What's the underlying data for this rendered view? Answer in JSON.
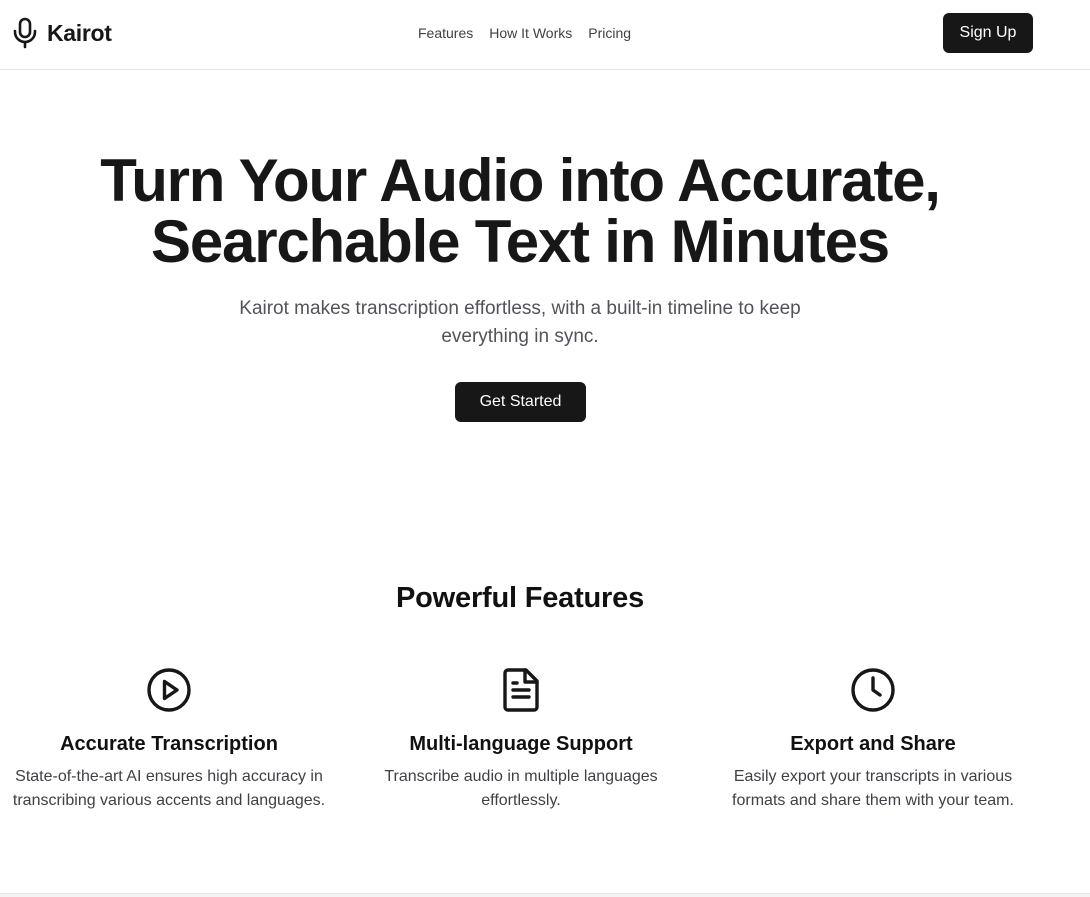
{
  "brand": {
    "name": "Kairot",
    "icon": "microphone-icon"
  },
  "nav": {
    "items": [
      "Features",
      "How It Works",
      "Pricing"
    ]
  },
  "header": {
    "signup_label": "Sign Up"
  },
  "hero": {
    "title_line1": "Turn Your Audio into Accurate,",
    "title_line2": "Searchable Text in Minutes",
    "subtitle_line1": "Kairot makes transcription effortless, with a built-in timeline to keep",
    "subtitle_line2": "everything in sync.",
    "cta_label": "Get Started"
  },
  "features": {
    "title": "Powerful Features",
    "items": [
      {
        "icon": "play-circle-icon",
        "title": "Accurate Transcription",
        "desc_line1": "State-of-the-art AI ensures high accuracy in",
        "desc_line2": "transcribing various accents and languages."
      },
      {
        "icon": "document-icon",
        "title": "Multi-language Support",
        "desc_line1": "Transcribe audio in multiple languages",
        "desc_line2": "effortlessly."
      },
      {
        "icon": "clock-icon",
        "title": "Export and Share",
        "desc_line1": "Easily export your transcripts in various",
        "desc_line2": "formats and share them with your team."
      }
    ]
  },
  "colors": {
    "primary": "#171717",
    "text_muted": "#52525b",
    "border": "#e5e5e5"
  }
}
